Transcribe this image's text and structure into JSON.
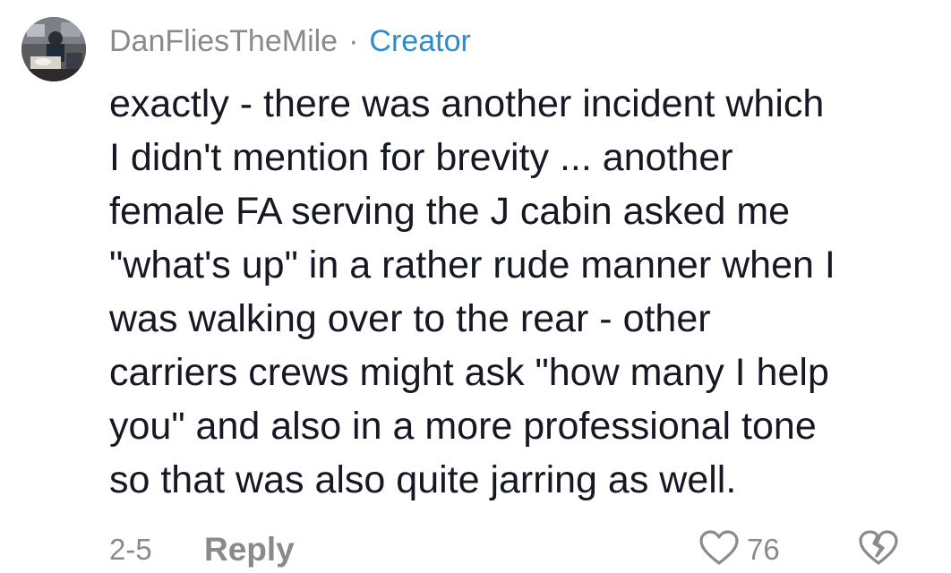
{
  "comment": {
    "username": "DanFliesTheMile",
    "separator": "·",
    "badge": "Creator",
    "lines": [
      "exactly - there was another incident which",
      "I didn't mention for brevity ... another",
      "female FA serving the J cabin asked me",
      "\"what's up\" in a rather rude manner when I",
      "was walking over to the rear - other",
      "carriers crews might ask \"how many I help",
      "you\" and also in a more professional tone",
      "so that was also quite jarring as well."
    ],
    "date": "2-5",
    "reply_label": "Reply",
    "like_count": "76",
    "icons": {
      "like": "heart-outline-icon",
      "dislike": "broken-heart-icon"
    }
  },
  "colors": {
    "text": "#161823",
    "meta": "#8a8a8e",
    "creator": "#2f8ccb"
  }
}
